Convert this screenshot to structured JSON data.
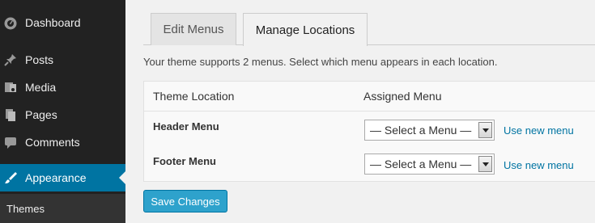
{
  "sidebar": {
    "items": [
      {
        "label": "Dashboard",
        "icon": "dashboard-icon"
      },
      {
        "label": "Posts",
        "icon": "pushpin-icon"
      },
      {
        "label": "Media",
        "icon": "media-icon"
      },
      {
        "label": "Pages",
        "icon": "pages-icon"
      },
      {
        "label": "Comments",
        "icon": "comments-icon"
      },
      {
        "label": "Appearance",
        "icon": "paintbrush-icon"
      }
    ],
    "submenu": {
      "label": "Themes"
    }
  },
  "tabs": {
    "edit_menus": "Edit Menus",
    "manage_locations": "Manage Locations"
  },
  "intro": "Your theme supports 2 menus. Select which menu appears in each location.",
  "locations": {
    "col_location": "Theme Location",
    "col_menu": "Assigned Menu",
    "rows": [
      {
        "label": "Header Menu",
        "selected": "— Select a Menu —",
        "link": "Use new menu"
      },
      {
        "label": "Footer Menu",
        "selected": "— Select a Menu —",
        "link": "Use new menu"
      }
    ]
  },
  "save_button": "Save Changes",
  "colors": {
    "sidebar_bg": "#222222",
    "active_bg": "#0074a2",
    "button_bg": "#2ea2cc",
    "link": "#0074a2"
  }
}
